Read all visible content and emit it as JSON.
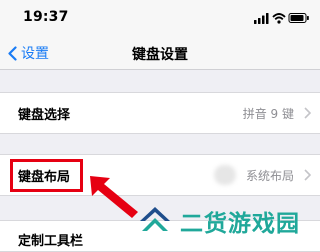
{
  "status_bar": {
    "time": "19:37"
  },
  "nav": {
    "back_label": "设置",
    "title": "键盘设置"
  },
  "rows": [
    {
      "label": "键盘选择",
      "value": "拼音 9 键"
    },
    {
      "label": "键盘布局",
      "value": "系统布局"
    },
    {
      "label": "定制工具栏",
      "value": ""
    }
  ],
  "watermark": {
    "text": "二货游戏园"
  },
  "colors": {
    "accent": "#1a7cf5",
    "highlight": "#e60012",
    "watermark": "#20a89a"
  }
}
